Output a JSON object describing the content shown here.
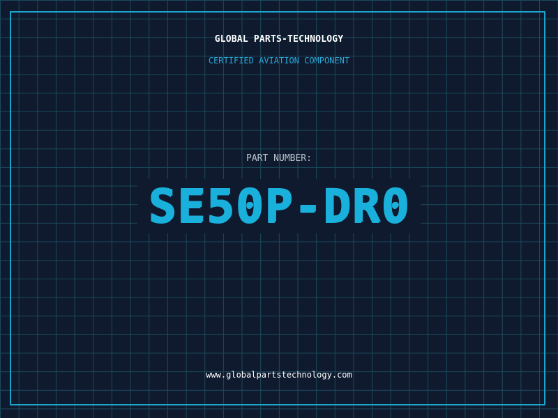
{
  "header": {
    "company": "GLOBAL PARTS-TECHNOLOGY",
    "subtitle": "CERTIFIED AVIATION COMPONENT"
  },
  "part": {
    "label": "PART NUMBER:",
    "number": "SE50P-DR0"
  },
  "footer": {
    "url": "www.globalpartstechnology.com"
  },
  "colors": {
    "background": "#0f1a2e",
    "grid": "#1b4a5c",
    "accent": "#1ab0dc",
    "frame": "#1aa6cc"
  }
}
